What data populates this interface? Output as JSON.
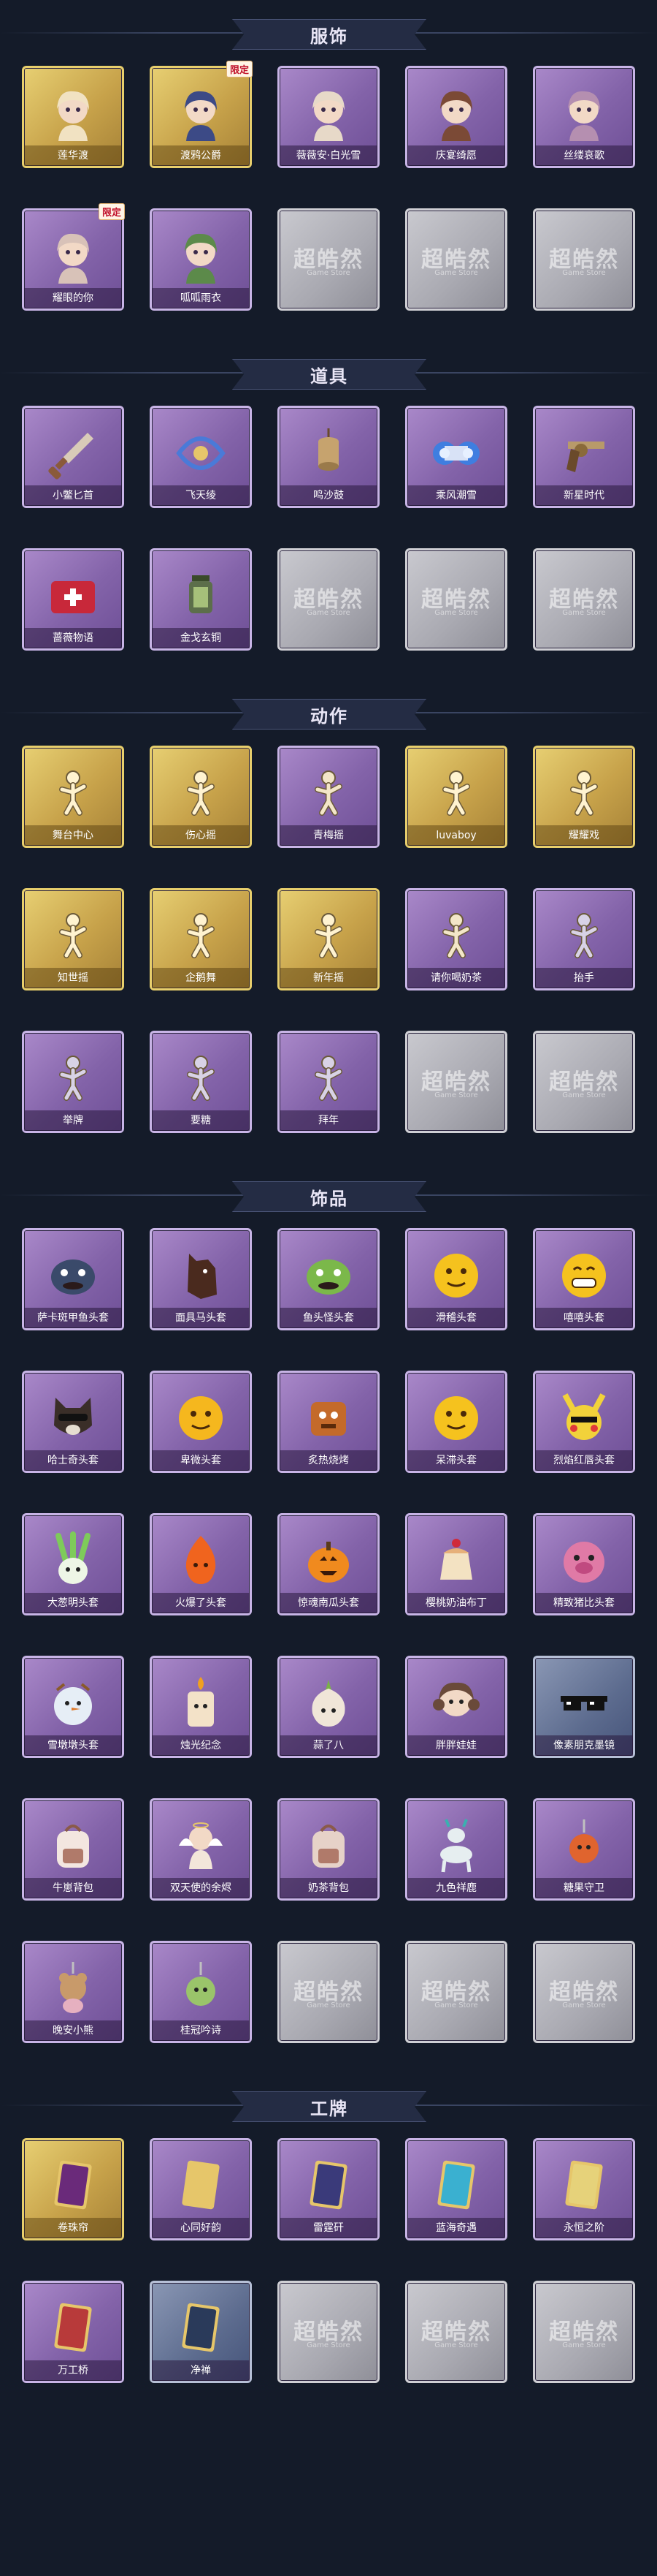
{
  "sections": [
    {
      "title": "服饰",
      "items": [
        {
          "name": "莲华渡",
          "tag": "",
          "style": "gold",
          "icon": "portrait-icon",
          "color": "#f1e2c2"
        },
        {
          "name": "渡鸦公爵",
          "tag": "限定",
          "style": "gold",
          "icon": "portrait-icon",
          "color": "#3c4a86"
        },
        {
          "name": "薇薇安·白光雪",
          "tag": "",
          "style": "purple",
          "icon": "portrait-icon",
          "color": "#e7d9c8"
        },
        {
          "name": "庆宴绮愿",
          "tag": "",
          "style": "purple",
          "icon": "portrait-icon",
          "color": "#7b4a36"
        },
        {
          "name": "丝缕哀歌",
          "tag": "",
          "style": "purple",
          "icon": "portrait-icon",
          "color": "#b58fb0"
        },
        {
          "name": "耀眼的你",
          "tag": "限定",
          "style": "purple",
          "icon": "portrait-icon",
          "color": "#d8c2b8"
        },
        {
          "name": "呱呱雨衣",
          "tag": "",
          "style": "purple",
          "icon": "portrait-icon",
          "color": "#5c8a4a"
        },
        {
          "name": "",
          "tag": "",
          "style": "empty",
          "icon": "",
          "color": ""
        },
        {
          "name": "",
          "tag": "",
          "style": "empty",
          "icon": "",
          "color": ""
        },
        {
          "name": "",
          "tag": "",
          "style": "empty",
          "icon": "",
          "color": ""
        }
      ]
    },
    {
      "title": "道具",
      "items": [
        {
          "name": "小鳖匕首",
          "tag": "",
          "style": "purple",
          "icon": "dagger-icon",
          "color": "#8a5a3a"
        },
        {
          "name": "飞天绫",
          "tag": "",
          "style": "purple",
          "icon": "ribbon-icon",
          "color": "#4a7ad8"
        },
        {
          "name": "鸣沙鼓",
          "tag": "",
          "style": "purple",
          "icon": "drum-icon",
          "color": "#c6a36e"
        },
        {
          "name": "乘风潮雪",
          "tag": "",
          "style": "purple",
          "icon": "machine-icon",
          "color": "#3f7ee0"
        },
        {
          "name": "新星时代",
          "tag": "",
          "style": "purple",
          "icon": "revolver-icon",
          "color": "#8a6a3a"
        },
        {
          "name": "蔷薇物语",
          "tag": "",
          "style": "purple",
          "icon": "medkit-icon",
          "color": "#c8283a"
        },
        {
          "name": "金戈玄铜",
          "tag": "",
          "style": "purple",
          "icon": "lantern-icon",
          "color": "#5c6e4a"
        },
        {
          "name": "",
          "tag": "",
          "style": "empty",
          "icon": "",
          "color": ""
        },
        {
          "name": "",
          "tag": "",
          "style": "empty",
          "icon": "",
          "color": ""
        },
        {
          "name": "",
          "tag": "",
          "style": "empty",
          "icon": "",
          "color": ""
        }
      ]
    },
    {
      "title": "动作",
      "items": [
        {
          "name": "舞台中心",
          "tag": "",
          "style": "gold",
          "icon": "pose-icon",
          "color": "#fff3d0"
        },
        {
          "name": "伤心摇",
          "tag": "",
          "style": "gold",
          "icon": "pose-icon",
          "color": "#fff3d0"
        },
        {
          "name": "青梅摇",
          "tag": "",
          "style": "purple",
          "icon": "pose-icon",
          "color": "#f3e6c8"
        },
        {
          "name": "luvaboy",
          "tag": "",
          "style": "gold",
          "icon": "pose-icon",
          "color": "#fff3d0"
        },
        {
          "name": "耀耀戏",
          "tag": "",
          "style": "gold",
          "icon": "pose-icon",
          "color": "#fff3d0"
        },
        {
          "name": "知世摇",
          "tag": "",
          "style": "gold",
          "icon": "pose-icon",
          "color": "#fff3d0"
        },
        {
          "name": "企鹅舞",
          "tag": "",
          "style": "gold",
          "icon": "pose-icon",
          "color": "#fff3d0"
        },
        {
          "name": "新年摇",
          "tag": "",
          "style": "gold",
          "icon": "pose-icon",
          "color": "#fff3d0"
        },
        {
          "name": "请你喝奶茶",
          "tag": "",
          "style": "purple",
          "icon": "pose-icon",
          "color": "#f3e6c8"
        },
        {
          "name": "抬手",
          "tag": "",
          "style": "purple",
          "icon": "pose-icon",
          "color": "#d8d2e6"
        },
        {
          "name": "举牌",
          "tag": "",
          "style": "purple",
          "icon": "pose-icon",
          "color": "#d8d2e6"
        },
        {
          "name": "要糖",
          "tag": "",
          "style": "purple",
          "icon": "pose-icon",
          "color": "#d8d2e6"
        },
        {
          "name": "拜年",
          "tag": "",
          "style": "purple",
          "icon": "pose-icon",
          "color": "#d8d2e6"
        },
        {
          "name": "",
          "tag": "",
          "style": "empty",
          "icon": "",
          "color": ""
        },
        {
          "name": "",
          "tag": "",
          "style": "empty",
          "icon": "",
          "color": ""
        }
      ]
    },
    {
      "title": "饰品",
      "items": [
        {
          "name": "萨卡斑甲鱼头套",
          "tag": "",
          "style": "purple",
          "icon": "fish-head-icon",
          "color": "#3a4a6a"
        },
        {
          "name": "面具马头套",
          "tag": "",
          "style": "purple",
          "icon": "horse-head-icon",
          "color": "#4a2a1e"
        },
        {
          "name": "鱼头怪头套",
          "tag": "",
          "style": "purple",
          "icon": "fish-head-icon",
          "color": "#7bb84a"
        },
        {
          "name": "滑稽头套",
          "tag": "",
          "style": "purple",
          "icon": "smiley-icon",
          "color": "#f5c21e"
        },
        {
          "name": "嘻嘻头套",
          "tag": "",
          "style": "purple",
          "icon": "grin-icon",
          "color": "#f5c21e"
        },
        {
          "name": "哈士奇头套",
          "tag": "",
          "style": "purple",
          "icon": "dog-head-icon",
          "color": "#3a2e28"
        },
        {
          "name": "卑微头套",
          "tag": "",
          "style": "purple",
          "icon": "smiley-icon",
          "color": "#f5b71e"
        },
        {
          "name": "炙热烧烤",
          "tag": "",
          "style": "purple",
          "icon": "toast-icon",
          "color": "#c46a2a"
        },
        {
          "name": "呆滞头套",
          "tag": "",
          "style": "purple",
          "icon": "smiley-icon",
          "color": "#f5c21e"
        },
        {
          "name": "烈焰红唇头套",
          "tag": "",
          "style": "purple",
          "icon": "pikachu-icon",
          "color": "#f2d23a"
        },
        {
          "name": "大葱明头套",
          "tag": "",
          "style": "purple",
          "icon": "scallion-icon",
          "color": "#7ecb5a"
        },
        {
          "name": "火爆了头套",
          "tag": "",
          "style": "purple",
          "icon": "flame-icon",
          "color": "#f0641e"
        },
        {
          "name": "惊魂南瓜头套",
          "tag": "",
          "style": "purple",
          "icon": "pumpkin-icon",
          "color": "#f08a1e"
        },
        {
          "name": "樱桃奶油布丁",
          "tag": "",
          "style": "purple",
          "icon": "pudding-icon",
          "color": "#f3e2c2"
        },
        {
          "name": "精致猪比头套",
          "tag": "",
          "style": "purple",
          "icon": "pig-icon",
          "color": "#e07aa6"
        },
        {
          "name": "雪墩墩头套",
          "tag": "",
          "style": "purple",
          "icon": "snowman-icon",
          "color": "#e6eef6"
        },
        {
          "name": "烛光纪念",
          "tag": "",
          "style": "purple",
          "icon": "candle-icon",
          "color": "#f3e2c8"
        },
        {
          "name": "蒜了八",
          "tag": "",
          "style": "purple",
          "icon": "garlic-icon",
          "color": "#f0e6d8"
        },
        {
          "name": "胖胖娃娃",
          "tag": "",
          "style": "purple",
          "icon": "doll-icon",
          "color": "#6a4a3a"
        },
        {
          "name": "像素朋克墨镜",
          "tag": "",
          "style": "slate",
          "icon": "sunglasses-icon",
          "color": "#111111"
        },
        {
          "name": "牛崽背包",
          "tag": "",
          "style": "purple",
          "icon": "backpack-icon",
          "color": "#f3e6e0"
        },
        {
          "name": "双天使的余烬",
          "tag": "",
          "style": "purple",
          "icon": "angel-icon",
          "color": "#f3e6da"
        },
        {
          "name": "奶茶背包",
          "tag": "",
          "style": "purple",
          "icon": "backpack-icon",
          "color": "#e6d2c8"
        },
        {
          "name": "九色祥鹿",
          "tag": "",
          "style": "purple",
          "icon": "deer-icon",
          "color": "#e6eef0"
        },
        {
          "name": "糖果守卫",
          "tag": "",
          "style": "purple",
          "icon": "charm-icon",
          "color": "#e0642e"
        },
        {
          "name": "晚安小熊",
          "tag": "",
          "style": "purple",
          "icon": "bear-charm-icon",
          "color": "#c89a6a"
        },
        {
          "name": "桂冠吟诗",
          "tag": "",
          "style": "purple",
          "icon": "charm-icon",
          "color": "#9ac46a"
        },
        {
          "name": "",
          "tag": "",
          "style": "empty",
          "icon": "",
          "color": ""
        },
        {
          "name": "",
          "tag": "",
          "style": "empty",
          "icon": "",
          "color": ""
        },
        {
          "name": "",
          "tag": "",
          "style": "empty",
          "icon": "",
          "color": ""
        }
      ]
    },
    {
      "title": "工牌",
      "items": [
        {
          "name": "卷珠帘",
          "tag": "",
          "style": "gold",
          "icon": "badge-card-icon",
          "color": "#6a2a7a"
        },
        {
          "name": "心同好韵",
          "tag": "",
          "style": "purple",
          "icon": "badge-card-icon",
          "color": "#e6c66a"
        },
        {
          "name": "雷霆矸",
          "tag": "",
          "style": "purple",
          "icon": "badge-card-icon",
          "color": "#3a3a7a"
        },
        {
          "name": "蓝海奇遇",
          "tag": "",
          "style": "purple",
          "icon": "badge-card-icon",
          "color": "#3ab0d0"
        },
        {
          "name": "永恒之阶",
          "tag": "",
          "style": "purple",
          "icon": "badge-card-icon",
          "color": "#e6d27a"
        },
        {
          "name": "万工桥",
          "tag": "",
          "style": "purple",
          "icon": "badge-card-icon",
          "color": "#b83a3a"
        },
        {
          "name": "净禅",
          "tag": "",
          "style": "slate",
          "icon": "badge-card-icon",
          "color": "#2a3a5a"
        },
        {
          "name": "",
          "tag": "",
          "style": "empty",
          "icon": "",
          "color": ""
        },
        {
          "name": "",
          "tag": "",
          "style": "empty",
          "icon": "",
          "color": ""
        },
        {
          "name": "",
          "tag": "",
          "style": "empty",
          "icon": "",
          "color": ""
        }
      ]
    }
  ],
  "empty_slot": {
    "watermark": "超皓然",
    "watermark_sub": "Game Store"
  },
  "theme": {
    "background": "#141b29",
    "banner": "#242c44",
    "purple": "#8363a9",
    "gold": "#c7a24a"
  }
}
